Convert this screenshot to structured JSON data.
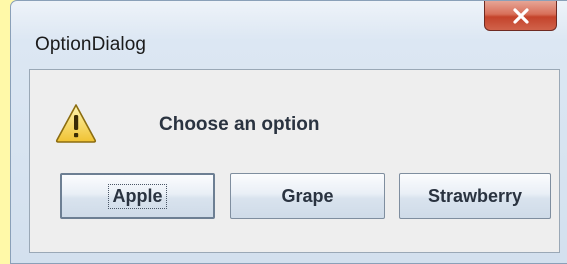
{
  "window": {
    "title": "OptionDialog",
    "close_icon": "close-x-icon"
  },
  "dialog": {
    "icon": "warning-icon",
    "message": "Choose an option",
    "buttons": [
      {
        "label": "Apple",
        "focused": true
      },
      {
        "label": "Grape",
        "focused": false
      },
      {
        "label": "Strawberry",
        "focused": false
      }
    ]
  },
  "colors": {
    "page_background": "#fff9a8",
    "close_button": "#c4432b",
    "warning_fill": "#f5d44a"
  }
}
